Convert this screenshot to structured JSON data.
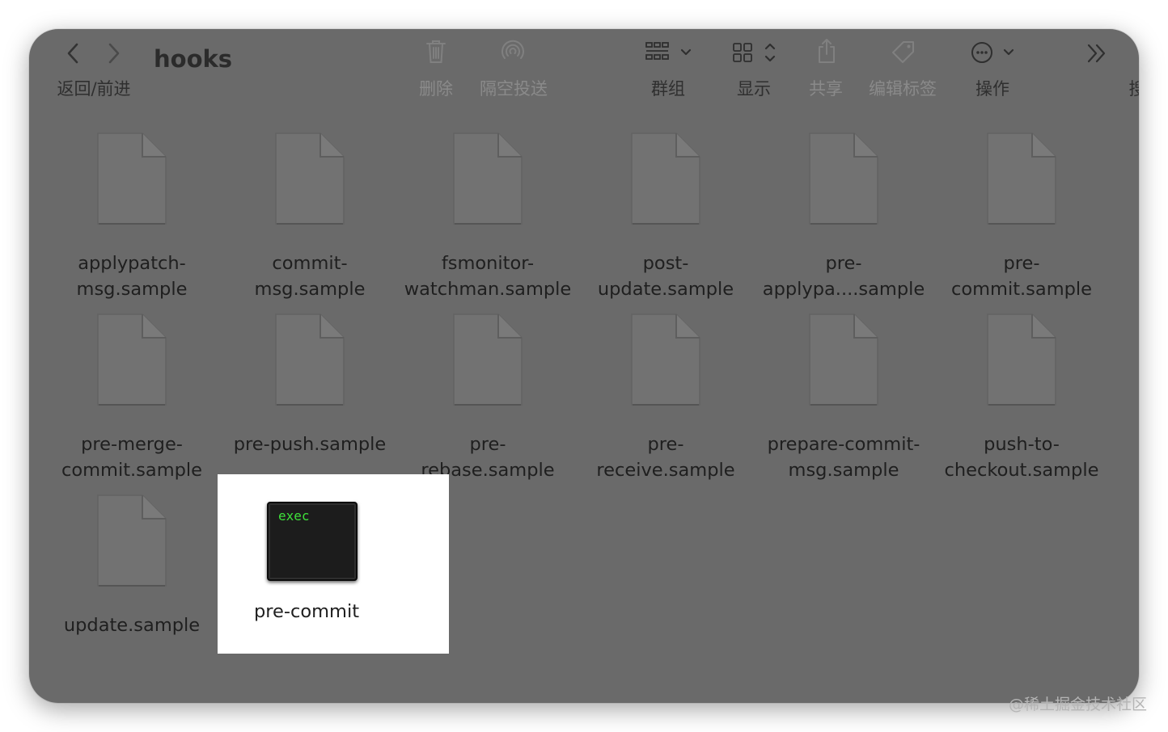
{
  "toolbar": {
    "title": "hooks",
    "nav_label": "返回/前进",
    "delete_label": "删除",
    "airdrop_label": "隔空投送",
    "group_label": "群组",
    "view_label": "显示",
    "share_label": "共享",
    "tags_label": "编辑标签",
    "action_label": "操作",
    "search_label_partial": "搜"
  },
  "files": [
    {
      "name": "applypatch-\nmsg.sample"
    },
    {
      "name": "commit-\nmsg.sample"
    },
    {
      "name": "fsmonitor-\nwatchman.sample"
    },
    {
      "name": "post-\nupdate.sample"
    },
    {
      "name": "pre-\napplypa....sample"
    },
    {
      "name": "pre-\ncommit.sample"
    },
    {
      "name": "pre-merge-\ncommit.sample"
    },
    {
      "name": "pre-push.sample"
    },
    {
      "name": "pre-\nrebase.sample"
    },
    {
      "name": "pre-\nreceive.sample"
    },
    {
      "name": "prepare-commit-\nmsg.sample"
    },
    {
      "name": "push-to-\ncheckout.sample"
    },
    {
      "name": "update.sample"
    }
  ],
  "selected_file": {
    "name": "pre-commit",
    "icon_text": "exec"
  },
  "watermark": "@稀土掘金技术社区",
  "colors": {
    "window_bg": "#6a6a6a",
    "exec_text": "#3ee13a",
    "selection_bg": "#ffffff"
  }
}
